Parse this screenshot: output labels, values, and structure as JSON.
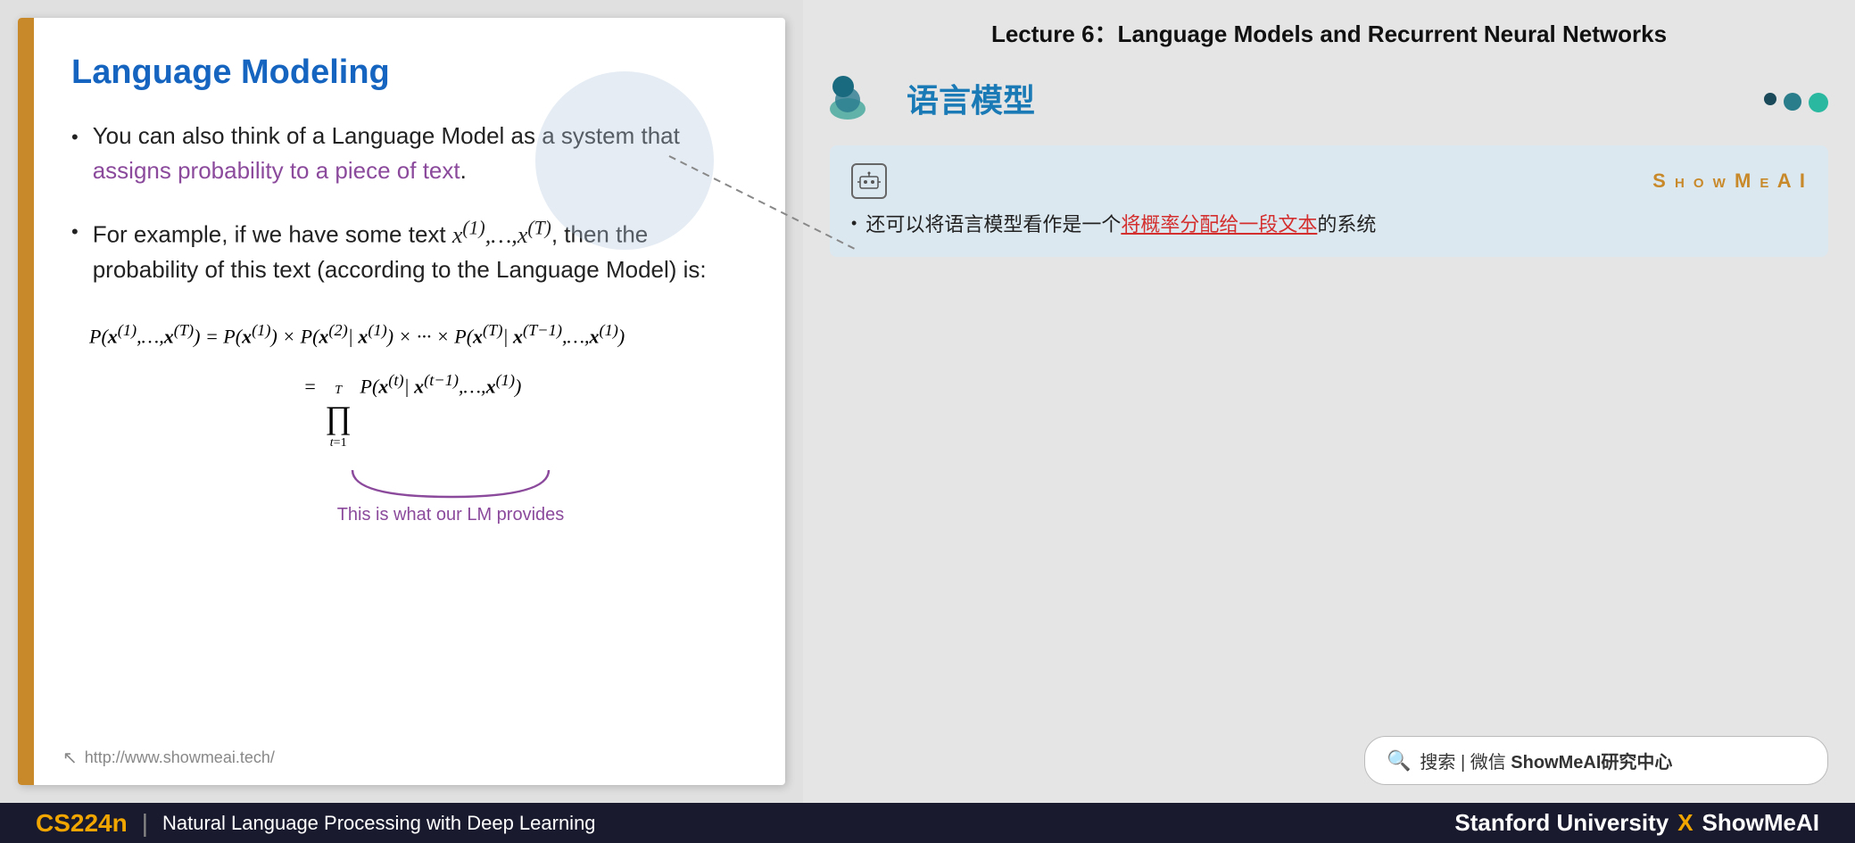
{
  "slide": {
    "title": "Language Modeling",
    "left_border_color": "#c8892a",
    "bullet1_text": "You can also think of a Language Model as a system that ",
    "bullet1_highlight": "assigns probability to a piece of text",
    "bullet1_end": ".",
    "bullet2_text": "For example, if we have some text ",
    "bullet2_math": "x⁽¹⁾,...,x⁽ᵀ⁾",
    "bullet2_cont": ", then the probability of this text (according to the Language Model) is:",
    "formula_main": "P(x⁽¹⁾,...,x⁽ᵀ⁾) = P(x⁽¹⁾) × P(x⁽²⁾| x⁽¹⁾) × ··· × P(x⁽ᵀ⁾| x⁽ᵀ⁻¹⁾,...,x⁽¹⁾)",
    "formula_prod": "= ∏ P(x⁽ᵗ⁾| x⁽ᵗ⁻¹⁾,...,x⁽¹⁾)",
    "formula_prod_limits": "T, t=1",
    "brace_label": "This is what our LM provides",
    "footer_url": "http://www.showmeai.tech/"
  },
  "right_panel": {
    "lecture_title": "Lecture 6：Language Models and Recurrent Neural Networks",
    "chinese_title": "语言模型",
    "teal_dots": [
      "small",
      "medium",
      "large"
    ],
    "ai_card": {
      "showmeai_label": "S h o w M e A I",
      "bullet_prefix": "还可以将语言模型看作是一个",
      "bullet_highlight": "将概率分配给一段文本",
      "bullet_suffix": "的系统"
    },
    "search_bar": {
      "icon": "🔍",
      "text": "搜索 | 微信 ShowMeAI研究中心"
    }
  },
  "bottom_bar": {
    "cs224n": "CS224n",
    "divider": "|",
    "course_name": "Natural Language Processing with Deep Learning",
    "stanford": "Stanford University",
    "x": "X",
    "showmeai": "ShowMeAI"
  }
}
